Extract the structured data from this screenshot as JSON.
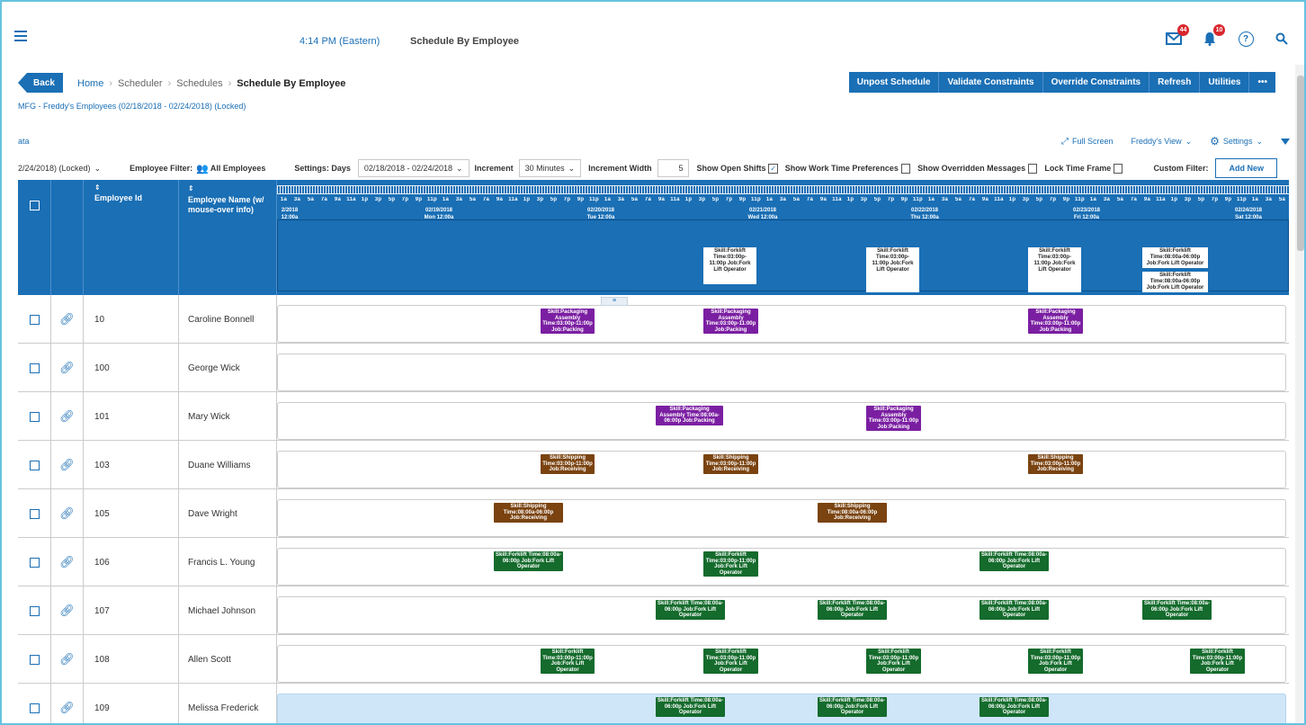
{
  "header": {
    "time": "4:14 PM (Eastern)",
    "title": "Schedule By Employee",
    "mail_badge": "44",
    "bell_badge": "10"
  },
  "breadcrumb": {
    "back": "Back",
    "items": [
      "Home",
      "Scheduler",
      "Schedules"
    ],
    "current": "Schedule By Employee",
    "subtitle": "MFG - Freddy's Employees (02/18/2018 - 02/24/2018) (Locked)"
  },
  "actions": [
    "Unpost Schedule",
    "Validate Constraints",
    "Override Constraints",
    "Refresh",
    "Utilities",
    "•••"
  ],
  "toolbar": {
    "data_tab": "ata",
    "full_screen": "Full Screen",
    "view": "Freddy's View",
    "settings": "Settings"
  },
  "settings_row": {
    "schedule_select": "2/24/2018) (Locked)",
    "employee_filter_label": "Employee Filter:",
    "employee_filter_value": "All Employees",
    "settings_days_label": "Settings:  Days",
    "date_range": "02/18/2018 - 02/24/2018",
    "increment_label": "Increment",
    "increment_value": "30 Minutes",
    "increment_width_label": "Increment Width",
    "increment_width_value": "5",
    "show_open_shifts": "Show Open Shifts",
    "show_work_time": "Show Work Time Preferences",
    "show_overridden": "Show Overridden Messages",
    "lock_time_frame": "Lock Time Frame",
    "custom_filter": "Custom Filter:",
    "add_new": "Add New"
  },
  "grid": {
    "col_employee_id": "Employee Id",
    "col_employee_name": "Employee Name (w/ mouse-over info)",
    "hours": [
      "1a",
      "3a",
      "5a",
      "7a",
      "9a",
      "11a",
      "1p",
      "3p",
      "5p",
      "7p",
      "9p",
      "11p"
    ],
    "days": [
      {
        "date": "2/2018",
        "day": "12:00a"
      },
      {
        "date": "02/19/2018",
        "day": "Mon 12:00a"
      },
      {
        "date": "02/20/2018",
        "day": "Tue 12:00a"
      },
      {
        "date": "02/21/2018",
        "day": "Wed 12:00a"
      },
      {
        "date": "02/22/2018",
        "day": "Thu 12:00a"
      },
      {
        "date": "02/23/2018",
        "day": "Fri 12:00a"
      },
      {
        "date": "02/24/2018",
        "day": "Sat 12:00a"
      }
    ],
    "open_shifts": [
      {
        "text": "Skill:Forklift Time:03:00p- 11:00p Job:Fork Lift Operator"
      },
      {
        "text": "Skill:Forklift Time:03:00p- 11:00p Job:Fork Lift Operator"
      },
      {
        "text": "Skill:Forklift Time:03:00p- 11:00p Job:Fork Lift Operator"
      },
      {
        "text": "Skill:Forklift Time:08:00a-06:00p Job:Fork Lift Operator"
      }
    ]
  },
  "employees": [
    {
      "id": "10",
      "name": "Caroline Bonnell"
    },
    {
      "id": "100",
      "name": "George Wick"
    },
    {
      "id": "101",
      "name": "Mary Wick"
    },
    {
      "id": "103",
      "name": "Duane Williams"
    },
    {
      "id": "105",
      "name": "Dave Wright"
    },
    {
      "id": "106",
      "name": "Francis L. Young"
    },
    {
      "id": "107",
      "name": "Michael Johnson"
    },
    {
      "id": "108",
      "name": "Allen Scott"
    },
    {
      "id": "109",
      "name": "Melissa Frederick"
    }
  ],
  "shift_text": {
    "packing_eve": "Skill:Packaging Assembly Time:03:00p-11:00p Job:Packing",
    "packing_day": "Skill:Packaging Assembly Time:08:00a-06:00p Job:Packing",
    "shipping_eve": "Skill:Shipping Time:03:00p-11:00p Job:Receiving",
    "shipping_day": "Skill:Shipping Time:08:00a-06:00p Job:Receiving",
    "forklift_day": "Skill:Forklift Time:08:00a-06:00p Job:Fork Lift Operator",
    "forklift_eve": "Skill:Forklift Time:03:00p-11:00p Job:Fork Lift Operator"
  },
  "colors": {
    "accent": "#1a6fb5",
    "packing": "#7b1fa2",
    "shipping": "#7a4310",
    "forklift": "#146b2c",
    "highlight_row": "#cfe6f8"
  }
}
